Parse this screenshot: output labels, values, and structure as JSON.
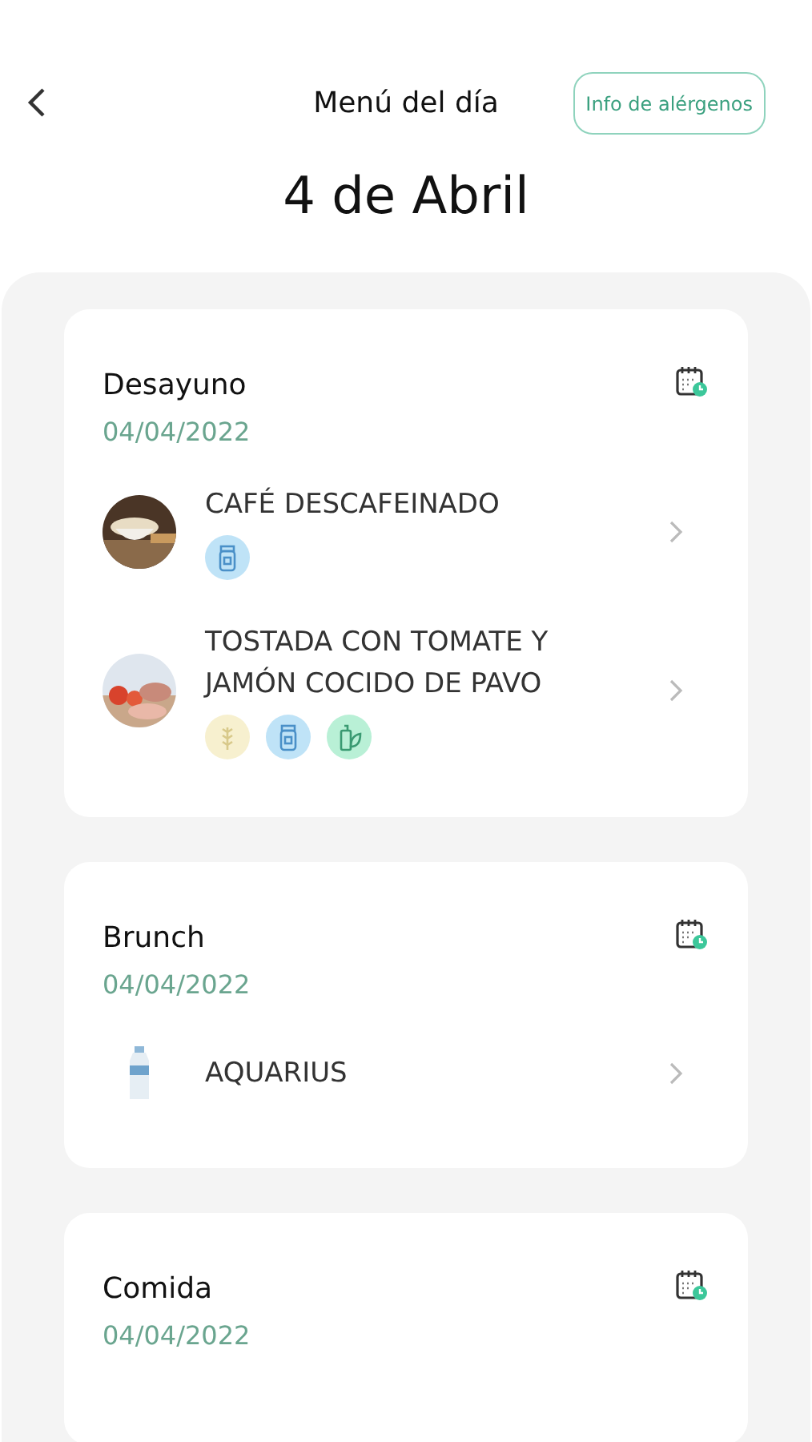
{
  "header": {
    "title": "Menú del día",
    "allergen_button": "Info de alérgenos",
    "date_heading": "4 de Abril"
  },
  "meals": [
    {
      "name": "Desayuno",
      "date": "04/04/2022",
      "dishes": [
        {
          "name": "CAFÉ DESCAFEINADO",
          "allergens": [
            {
              "kind": "milk",
              "color": "#bfe3f7"
            }
          ]
        },
        {
          "name": "TOSTADA CON TOMATE Y JAMÓN COCIDO DE PAVO",
          "allergens": [
            {
              "kind": "gluten",
              "color": "#f7f0cf"
            },
            {
              "kind": "milk",
              "color": "#bfe3f7"
            },
            {
              "kind": "soy",
              "color": "#b9f0d6"
            }
          ]
        }
      ]
    },
    {
      "name": "Brunch",
      "date": "04/04/2022",
      "dishes": [
        {
          "name": "AQUARIUS"
        }
      ]
    },
    {
      "name": "Comida",
      "date": "04/04/2022"
    }
  ]
}
